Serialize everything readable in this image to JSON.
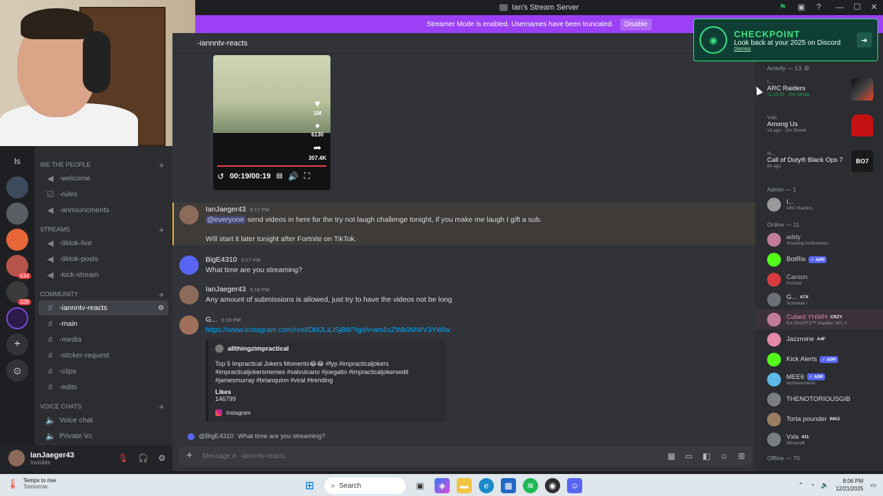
{
  "window": {
    "title": "Ian's Stream Server",
    "minimize": "—",
    "maximize": "☐",
    "close": "✕"
  },
  "banner": {
    "text": "Streamer Mode is enabled. Usernames have been truncated.",
    "button": "Disable"
  },
  "checkpoint": {
    "title": "CHECKPOINT",
    "subtitle": "Look back at your 2025 on Discord",
    "dismiss": "Dismiss",
    "accent": "#3be384"
  },
  "rail": {
    "items": [
      {
        "label": "Is",
        "badge": ""
      },
      {
        "label": "",
        "badge": ""
      },
      {
        "label": "",
        "badge": ""
      },
      {
        "label": "",
        "badge": ""
      },
      {
        "label": "",
        "badge": "634"
      },
      {
        "label": "",
        "badge": "328"
      },
      {
        "label": "",
        "badge": ""
      },
      {
        "label": "+",
        "badge": ""
      },
      {
        "label": "⊙",
        "badge": ""
      }
    ]
  },
  "channels": {
    "categories": [
      {
        "name": "WE THE PEOPLE",
        "items": [
          "-welcome",
          "-rules",
          "-announcments"
        ]
      },
      {
        "name": "STREAMS",
        "items": [
          "-tiktok-live",
          "-tiktok-posts",
          "-kick-stream"
        ]
      },
      {
        "name": "COMMUNITY",
        "items": [
          "-iannntv-reacts",
          "-main",
          "-media",
          "-sticker-request",
          "-clips",
          "-edits"
        ]
      },
      {
        "name": "VOICE CHATS",
        "items": [
          "Voice chat",
          "Private Vc"
        ]
      }
    ]
  },
  "user": {
    "name": "IanJaeger43",
    "status": "Invisible"
  },
  "chat": {
    "channel": "-iannntv-reacts",
    "video": {
      "likes": "1M",
      "comments": "6130",
      "shares": "307.4K",
      "time": "00:19/00:19"
    },
    "messages": [
      {
        "author": "IanJaeger43",
        "time": "5:17 PM",
        "mention": "@everyone",
        "text": " send videos in here for the try not laugh challenge tonight, if you make me laugh I gift a sub.",
        "text2": "Will start it later tonight after Fortnite on TikTok."
      },
      {
        "author": "BigE4310",
        "time": "5:17 PM",
        "text": "What time are you streaming?"
      },
      {
        "author": "IanJaeger43",
        "time": "5:18 PM",
        "text": "Any amount of submissions is allowed, just try to have the videos not be long"
      },
      {
        "author": "G...",
        "time": "5:18 PM",
        "link": "https://www.instagram.com/reel/DMJLiLiSjB8/?igsh=am1sZWk0MWV3YWlw"
      }
    ],
    "embed": {
      "author": "allthingzimpractical",
      "description": "Top 5 Impractical Jokers Moments😂😂 #fyp #impracticaljokers #impracticaljokersmemes #salvulcano #joegatto #impracticaljokersedit #jamesmurray #brianquinn #viral #trending",
      "field_name": "Likes",
      "field_value": "146799",
      "footer": "Instagram"
    },
    "reply": {
      "mention": "@BigE4310",
      "text": "What time are you streaming?"
    },
    "composer_placeholder": "Message #  -iannntv-reacts"
  },
  "members": {
    "activity_header": "Activity — 13",
    "activities": [
      {
        "user": "I...",
        "game": "ARC Raiders",
        "meta": "11:10:29 · 20x Streak"
      },
      {
        "user": "Vxls",
        "game": "Among Us",
        "meta": "1d ago · 15x Streak"
      },
      {
        "user": "N...",
        "game": "Call of Duty® Black Ops 7",
        "meta": "8h ago"
      }
    ],
    "admin_header": "Admin — 1",
    "admin": {
      "name": "I...",
      "sub": "ARC Raiders"
    },
    "online_header": "Online — 11",
    "online": [
      {
        "name": "addy",
        "sub": "Smoking tombstones",
        "tag": ""
      },
      {
        "name": "BotRix",
        "sub": "",
        "tag": "✓ APP"
      },
      {
        "name": "Carson",
        "sub": "Fortnite",
        "tag": ""
      },
      {
        "name": "G...",
        "sub": "Schedule I",
        "tag": "A7X"
      },
      {
        "name": "Cubed YHWH",
        "sub": "EA SPORTS™ Madden NFL 2",
        "tag": "CRZY"
      },
      {
        "name": "Jazzmine",
        "sub": "",
        "tag": "A4F"
      },
      {
        "name": "Kick Alerts",
        "sub": "",
        "tag": "✓ APP"
      },
      {
        "name": "MEE6",
        "sub": "/achievements",
        "tag": "✓ APP"
      },
      {
        "name": "THENOTORIOUSGIB",
        "sub": "",
        "tag": ""
      },
      {
        "name": "Torta pounder",
        "sub": "",
        "tag": "INK2"
      },
      {
        "name": "Vxls",
        "sub": "Minecraft",
        "tag": "411"
      }
    ],
    "offline_header": "Offline — 70"
  },
  "taskbar": {
    "weather": "Temps to rise",
    "weather2": "Tomorrow",
    "search": "Search",
    "time": "8:06 PM",
    "date": "12/21/2025"
  },
  "colors": {
    "accent": "#9b40f5",
    "mention": "#5865f2",
    "link": "#00a8fc"
  }
}
